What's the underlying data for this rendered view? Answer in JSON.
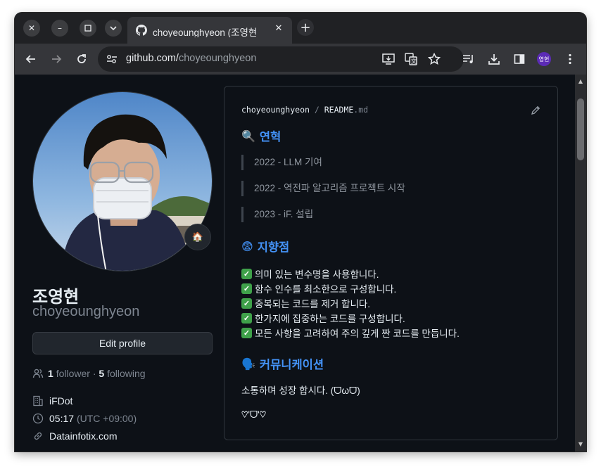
{
  "browser": {
    "tab_title": "choyeounghyeon (조영현",
    "url_host": "github.com/",
    "url_path": "choyeounghyeon",
    "profile_initials": "영현"
  },
  "profile": {
    "name": "조영현",
    "login": "choyeounghyeon",
    "edit_label": "Edit profile",
    "followers_count": "1",
    "followers_label": "follower",
    "following_count": "5",
    "following_label": "following",
    "company": "iFDot",
    "local_time": "05:17",
    "timezone": "(UTC +09:00)",
    "website": "Datainfotix.com"
  },
  "readme": {
    "owner": "choyeounghyeon",
    "separator": "/",
    "file_base": "README",
    "file_ext": ".md",
    "history": {
      "emoji": "🔍",
      "title": "연혁",
      "items": [
        "2022 - LLM 기여",
        "2022 - 역전파 알고리즘 프로젝트 시작",
        "2023 - iF. 설립"
      ]
    },
    "goals": {
      "emoji": "😨",
      "title": "지향점",
      "items": [
        "의미 있는 변수명을 사용합니다.",
        "함수 인수를 최소한으로 구성합니다.",
        "중복되는 코드를 제거 합니다.",
        "한가지에 집중하는 코드를 구성합니다.",
        "모든 사항을 고려하여 주의 깊게 짠 코드를 만듭니다."
      ]
    },
    "communication": {
      "emoji": "🗣️",
      "title": "커뮤니케이션",
      "text": "소통하며 성장 합시다. (ᗜωᗜ)",
      "footer": "♡'ᗜ'♡"
    }
  }
}
